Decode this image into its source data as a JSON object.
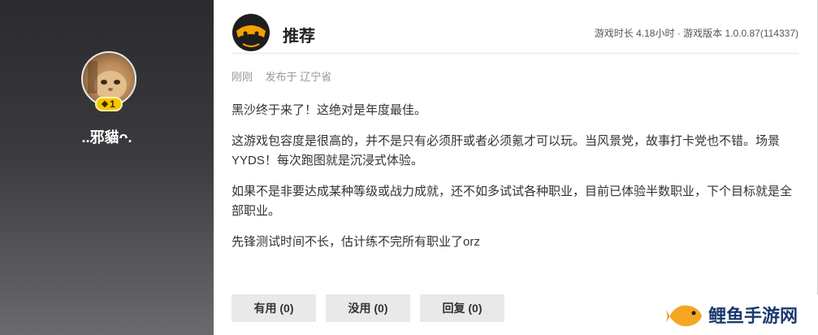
{
  "user": {
    "name": "..邪貓ᴖ.",
    "level": "1"
  },
  "review": {
    "tag": "推荐",
    "playtime": "游戏时长 4.18小时 · 游戏版本 1.0.0.87(114337)",
    "time": "刚刚",
    "location": "发布于 辽宁省",
    "paragraphs": [
      "黑沙终于来了！这绝对是年度最佳。",
      "这游戏包容度是很高的，并不是只有必须肝或者必须氪才可以玩。当风景党，故事打卡党也不错。场景YYDS！每次跑图就是沉浸式体验。",
      "如果不是非要达成某种等级或战力成就，还不如多试试各种职业，目前已体验半数职业，下个目标就是全部职业。",
      "先锋测试时间不长，估计练不完所有职业了orz"
    ]
  },
  "actions": {
    "useful": "有用 (0)",
    "useless": "没用 (0)",
    "reply": "回复 (0)"
  },
  "watermark": {
    "text": "鲤鱼手游网"
  },
  "colors": {
    "panel_dark": "#2b2b2e",
    "badge_gold": "#f5c400",
    "logo_orange": "#f5a000",
    "watermark_blue": "#1a3a6e"
  }
}
